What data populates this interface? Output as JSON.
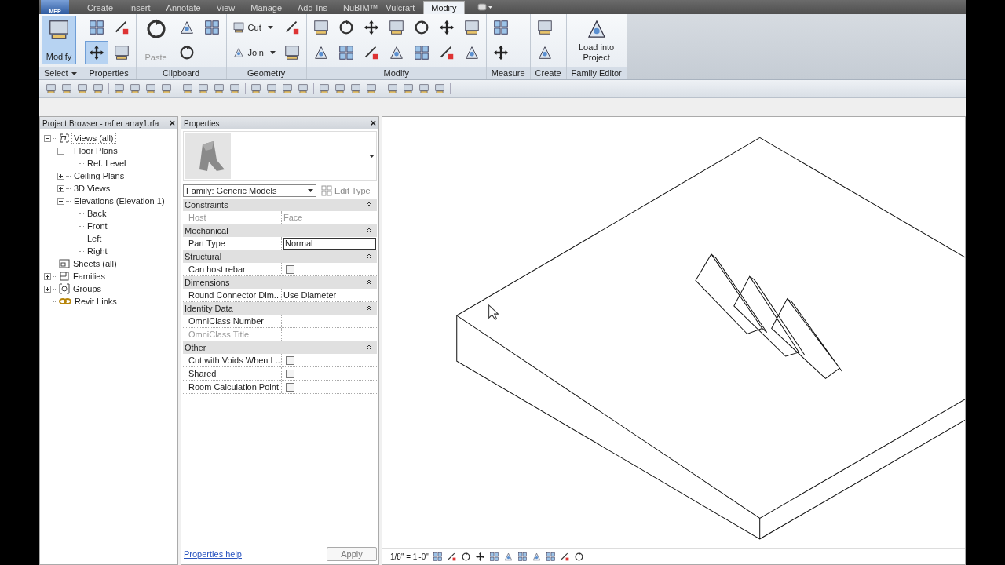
{
  "app_button": {
    "label": "MEP"
  },
  "tabs": [
    {
      "label": "Create",
      "selected": false
    },
    {
      "label": "Insert",
      "selected": false
    },
    {
      "label": "Annotate",
      "selected": false
    },
    {
      "label": "View",
      "selected": false
    },
    {
      "label": "Manage",
      "selected": false
    },
    {
      "label": "Add-Ins",
      "selected": false
    },
    {
      "label": "NuBIM™ - Vulcraft",
      "selected": false
    },
    {
      "label": "Modify",
      "selected": true
    }
  ],
  "ribbon": [
    {
      "title": "Select",
      "menu": true,
      "tools": [
        {
          "kind": "large",
          "label": "Modify",
          "selected": true
        }
      ]
    },
    {
      "title": "Properties",
      "menu": false,
      "tools": [
        {
          "kind": "icon",
          "selected": false
        },
        {
          "kind": "icon",
          "selected": true
        },
        {
          "kind": "icon",
          "selected": false
        },
        {
          "kind": "icon",
          "selected": false
        }
      ]
    },
    {
      "title": "Clipboard",
      "menu": false,
      "tools": [
        {
          "kind": "large",
          "label": "Paste",
          "disabled": true,
          "selected": false
        },
        {
          "kind": "icon",
          "selected": false
        },
        {
          "kind": "icon",
          "selected": false
        },
        {
          "kind": "icon",
          "selected": false
        }
      ]
    },
    {
      "title": "Geometry",
      "menu": false,
      "tools": [
        {
          "kind": "small",
          "label": "Cut"
        },
        {
          "kind": "small",
          "label": "Join"
        },
        {
          "kind": "icon",
          "selected": false
        },
        {
          "kind": "icon",
          "selected": false
        }
      ]
    },
    {
      "title": "Modify",
      "menu": false,
      "tools": [
        {
          "kind": "icon",
          "selected": false
        },
        {
          "kind": "icon",
          "selected": false
        },
        {
          "kind": "icon",
          "selected": false
        },
        {
          "kind": "icon",
          "selected": false
        },
        {
          "kind": "icon",
          "selected": false
        },
        {
          "kind": "icon",
          "selected": false
        },
        {
          "kind": "icon",
          "selected": false
        },
        {
          "kind": "icon",
          "selected": false
        },
        {
          "kind": "icon",
          "selected": false
        },
        {
          "kind": "icon",
          "selected": false
        },
        {
          "kind": "icon",
          "selected": false
        },
        {
          "kind": "icon",
          "selected": false
        },
        {
          "kind": "icon",
          "selected": false
        },
        {
          "kind": "icon",
          "selected": false
        }
      ]
    },
    {
      "title": "Measure",
      "menu": false,
      "tools": [
        {
          "kind": "icon",
          "selected": false
        },
        {
          "kind": "icon",
          "selected": false
        }
      ]
    },
    {
      "title": "Create",
      "menu": false,
      "tools": [
        {
          "kind": "icon",
          "selected": false
        },
        {
          "kind": "icon",
          "selected": false
        }
      ]
    },
    {
      "title": "Family Editor",
      "menu": false,
      "tools": [
        {
          "kind": "large",
          "label": "Load into Project",
          "selected": false
        }
      ]
    }
  ],
  "project_browser": {
    "title": "Project Browser - rafter array1.rfa",
    "close": "×",
    "tree": [
      {
        "label": "Views (all)",
        "kind": "views",
        "selected": true,
        "expanded": true,
        "children": [
          {
            "label": "Floor Plans",
            "selected": false,
            "expanded": true,
            "children": [
              {
                "label": "Ref. Level",
                "selected": false
              }
            ]
          },
          {
            "label": "Ceiling Plans",
            "selected": false,
            "expanded": false
          },
          {
            "label": "3D Views",
            "selected": false,
            "expanded": false
          },
          {
            "label": "Elevations (Elevation 1)",
            "selected": false,
            "expanded": true,
            "children": [
              {
                "label": "Back",
                "selected": false
              },
              {
                "label": "Front",
                "selected": false
              },
              {
                "label": "Left",
                "selected": false
              },
              {
                "label": "Right",
                "selected": false
              }
            ]
          }
        ]
      },
      {
        "label": "Sheets (all)",
        "kind": "sheets",
        "selected": false
      },
      {
        "label": "Families",
        "kind": "families",
        "selected": false,
        "expanded": false
      },
      {
        "label": "Groups",
        "kind": "groups",
        "selected": false,
        "expanded": false
      },
      {
        "label": "Revit Links",
        "kind": "links",
        "selected": false
      }
    ]
  },
  "properties": {
    "title": "Properties",
    "close": "×",
    "type_selector": "Family: Generic Models",
    "edit_type": "Edit Type",
    "groups": [
      {
        "name": "Constraints",
        "expanded": true,
        "rows": [
          {
            "label": "Host",
            "kind": "text",
            "value": "Face",
            "disabled": true
          }
        ]
      },
      {
        "name": "Mechanical",
        "expanded": true,
        "rows": [
          {
            "label": "Part Type",
            "kind": "input",
            "value": "Normal",
            "disabled": false
          }
        ]
      },
      {
        "name": "Structural",
        "expanded": true,
        "rows": [
          {
            "label": "Can host rebar",
            "kind": "checkbox",
            "checked": false,
            "disabled": false
          }
        ]
      },
      {
        "name": "Dimensions",
        "expanded": true,
        "rows": [
          {
            "label": "Round Connector Dim...",
            "kind": "text",
            "value": "Use Diameter",
            "disabled": false
          }
        ]
      },
      {
        "name": "Identity Data",
        "expanded": true,
        "rows": [
          {
            "label": "OmniClass Number",
            "kind": "text",
            "disabled": false
          },
          {
            "label": "OmniClass Title",
            "kind": "text",
            "disabled": true
          }
        ]
      },
      {
        "name": "Other",
        "expanded": true,
        "rows": [
          {
            "label": "Cut with Voids When L...",
            "kind": "checkbox",
            "checked": false,
            "disabled": false
          },
          {
            "label": "Shared",
            "kind": "checkbox",
            "checked": false,
            "disabled": false
          },
          {
            "label": "Room Calculation Point",
            "kind": "checkbox",
            "checked": false,
            "disabled": false
          }
        ]
      }
    ],
    "help_link": "Properties help",
    "apply": "Apply"
  },
  "view": {
    "scale": "1/8\" = 1'-0\""
  }
}
